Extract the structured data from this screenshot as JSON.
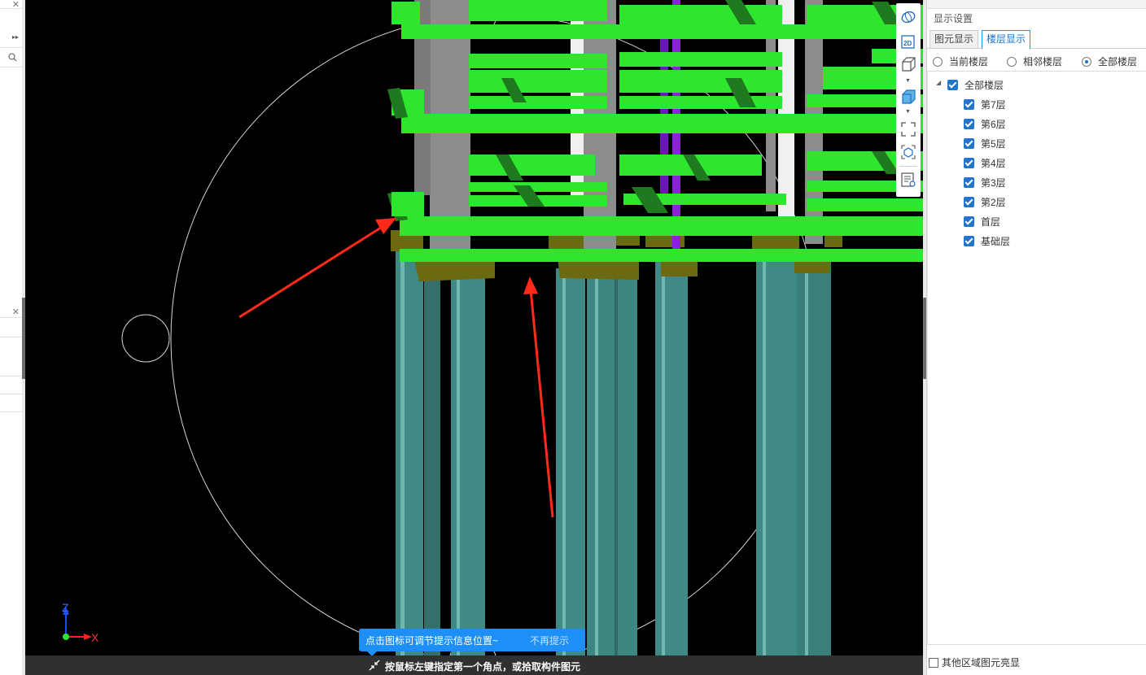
{
  "display_settings": {
    "title": "显示设置",
    "tabs": [
      {
        "label": "图元显示",
        "active": false
      },
      {
        "label": "楼层显示",
        "active": true
      }
    ],
    "floor_mode": {
      "options": [
        "当前楼层",
        "相邻楼层",
        "全部楼层"
      ],
      "selected": "全部楼层"
    },
    "tree": {
      "root": {
        "label": "全部楼层",
        "checked": true,
        "expanded": true
      },
      "floors": [
        {
          "label": "第7层",
          "checked": true
        },
        {
          "label": "第6层",
          "checked": true
        },
        {
          "label": "第5层",
          "checked": true
        },
        {
          "label": "第4层",
          "checked": true
        },
        {
          "label": "第3层",
          "checked": true
        },
        {
          "label": "第2层",
          "checked": true
        },
        {
          "label": "首层",
          "checked": true
        },
        {
          "label": "基础层",
          "checked": true
        }
      ]
    },
    "other_region_option": {
      "label": "其他区域图元亮显",
      "checked": false
    }
  },
  "viewport": {
    "tip_bubble": {
      "message": "点击图标可调节提示信息位置~",
      "dismiss": "不再提示"
    },
    "status_hint": "按鼠标左键指定第一个角点，或拾取构件图元",
    "axes": {
      "z": "Z",
      "x": "X"
    },
    "colors": {
      "background": "#000000",
      "slab_beam": "#2ee62e",
      "column": "#8c8c8c",
      "pile": "#3f8a86",
      "pile_cap": "#6b6a12",
      "annotation_arrow": "#ff2a1a",
      "purple_column": "#8a1fe0"
    }
  },
  "view_toolbar": {
    "icons": [
      "dynamic-observe-icon",
      "2d-view-icon",
      "3d-box-icon",
      "shaded-box-icon",
      "fullscreen-icon",
      "locate-view-icon",
      "display-settings-icon"
    ]
  }
}
